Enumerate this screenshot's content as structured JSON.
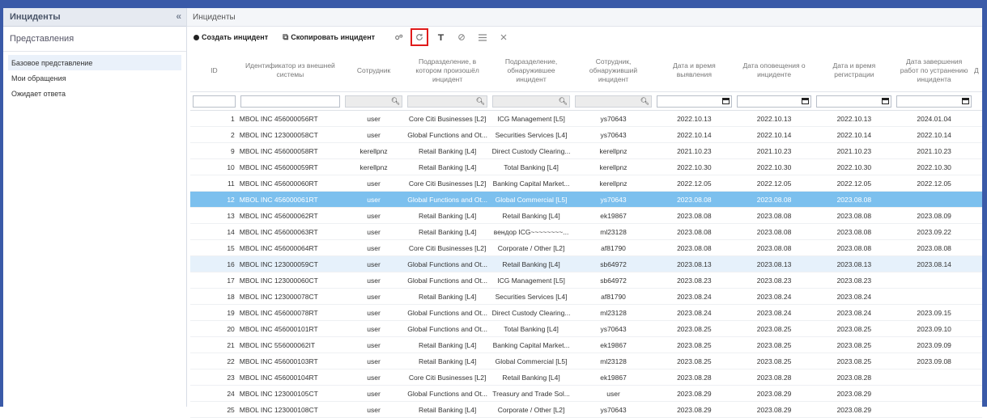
{
  "sidebar": {
    "title": "Инциденты",
    "collapse_glyph": "«",
    "section": "Представления",
    "items": [
      {
        "label": "Базовое представление",
        "active": true
      },
      {
        "label": "Мои обращения",
        "active": false
      },
      {
        "label": "Ожидает ответа",
        "active": false
      }
    ]
  },
  "main": {
    "title": "Инциденты",
    "toolbar": {
      "create_label": "Создать инцидент",
      "copy_label": "Скопировать инцидент",
      "icons": [
        "settings-icon",
        "refresh-icon",
        "filter-icon",
        "clear-icon",
        "columns-icon",
        "close-icon"
      ],
      "highlight_color": "#e01b1b"
    }
  },
  "table": {
    "columns": [
      "ID",
      "Идентификатор из внешней системы",
      "Сотрудник",
      "Подразделение, в котором произошёл инцидент",
      "Подразделение, обнаружившее инцидент",
      "Сотрудник, обнаруживший инцидент",
      "Дата и время выявления",
      "Дата оповещения о инциденте",
      "Дата и время регистрации",
      "Дата завершения работ по устранению инцидента",
      "Д"
    ],
    "rows": [
      [
        "1",
        "MBOL INC 456000056RT",
        "user",
        "Core Citi Businesses [L2]",
        "ICG Management [L5]",
        "ys70643",
        "2022.10.13",
        "2022.10.13",
        "2022.10.13",
        "2024.01.04"
      ],
      [
        "2",
        "MBOL INC 123000058CT",
        "user",
        "Global Functions and Ot...",
        "Securities Services [L4]",
        "ys70643",
        "2022.10.14",
        "2022.10.14",
        "2022.10.14",
        "2022.10.14"
      ],
      [
        "9",
        "MBOL INC 456000058RT",
        "kerellpnz",
        "Retail Banking [L4]",
        "Direct Custody Clearing...",
        "kerellpnz",
        "2021.10.23",
        "2021.10.23",
        "2021.10.23",
        "2021.10.23"
      ],
      [
        "10",
        "MBOL INC 456000059RT",
        "kerellpnz",
        "Retail Banking [L4]",
        "Total Banking [L4]",
        "kerellpnz",
        "2022.10.30",
        "2022.10.30",
        "2022.10.30",
        "2022.10.30"
      ],
      [
        "11",
        "MBOL INC 456000060RT",
        "user",
        "Core Citi Businesses [L2]",
        "Banking Capital Market...",
        "kerellpnz",
        "2022.12.05",
        "2022.12.05",
        "2022.12.05",
        "2022.12.05"
      ],
      [
        "12",
        "MBOL INC 456000061RT",
        "user",
        "Global Functions and Ot...",
        "Global Commercial [L5]",
        "ys70643",
        "2023.08.08",
        "2023.08.08",
        "2023.08.08",
        ""
      ],
      [
        "13",
        "MBOL INC 456000062RT",
        "user",
        "Retail Banking [L4]",
        "Retail Banking [L4]",
        "ek19867",
        "2023.08.08",
        "2023.08.08",
        "2023.08.08",
        "2023.08.09"
      ],
      [
        "14",
        "MBOL INC 456000063RT",
        "user",
        "Retail Banking [L4]",
        "вендор ICG~~~~~~~~...",
        "ml23128",
        "2023.08.08",
        "2023.08.08",
        "2023.08.08",
        "2023.09.22"
      ],
      [
        "15",
        "MBOL INC 456000064RT",
        "user",
        "Core Citi Businesses [L2]",
        "Corporate / Other [L2]",
        "af81790",
        "2023.08.08",
        "2023.08.08",
        "2023.08.08",
        "2023.08.08"
      ],
      [
        "16",
        "MBOL INC 123000059CT",
        "user",
        "Global Functions and Ot...",
        "Retail Banking [L4]",
        "sb64972",
        "2023.08.13",
        "2023.08.13",
        "2023.08.13",
        "2023.08.14"
      ],
      [
        "17",
        "MBOL INC 123000060CT",
        "user",
        "Global Functions and Ot...",
        "ICG Management [L5]",
        "sb64972",
        "2023.08.23",
        "2023.08.23",
        "2023.08.23",
        ""
      ],
      [
        "18",
        "MBOL INC 123000078CT",
        "user",
        "Retail Banking [L4]",
        "Securities Services [L4]",
        "af81790",
        "2023.08.24",
        "2023.08.24",
        "2023.08.24",
        ""
      ],
      [
        "19",
        "MBOL INC 456000078RT",
        "user",
        "Global Functions and Ot...",
        "Direct Custody Clearing...",
        "ml23128",
        "2023.08.24",
        "2023.08.24",
        "2023.08.24",
        "2023.09.15"
      ],
      [
        "20",
        "MBOL INC 456000101RT",
        "user",
        "Global Functions and Ot...",
        "Total Banking [L4]",
        "ys70643",
        "2023.08.25",
        "2023.08.25",
        "2023.08.25",
        "2023.09.10"
      ],
      [
        "21",
        "MBOL INC 556000062IT",
        "user",
        "Retail Banking [L4]",
        "Banking Capital Market...",
        "ek19867",
        "2023.08.25",
        "2023.08.25",
        "2023.08.25",
        "2023.09.09"
      ],
      [
        "22",
        "MBOL INC 456000103RT",
        "user",
        "Retail Banking [L4]",
        "Global Commercial [L5]",
        "ml23128",
        "2023.08.25",
        "2023.08.25",
        "2023.08.25",
        "2023.09.08"
      ],
      [
        "23",
        "MBOL INC 456000104RT",
        "user",
        "Core Citi Businesses [L2]",
        "Retail Banking [L4]",
        "ek19867",
        "2023.08.28",
        "2023.08.28",
        "2023.08.28",
        ""
      ],
      [
        "24",
        "MBOL INC 123000105CT",
        "user",
        "Global Functions and Ot...",
        "Treasury and Trade Sol...",
        "user",
        "2023.08.29",
        "2023.08.29",
        "2023.08.29",
        ""
      ],
      [
        "25",
        "MBOL INC 123000108CT",
        "user",
        "Retail Banking [L4]",
        "Corporate / Other [L2]",
        "ys70643",
        "2023.08.29",
        "2023.08.29",
        "2023.08.29",
        ""
      ]
    ],
    "selected_row_index": 5,
    "hover_row_index": 9,
    "selected_color": "#7cc0ee",
    "hover_color": "#e6f1fb"
  }
}
